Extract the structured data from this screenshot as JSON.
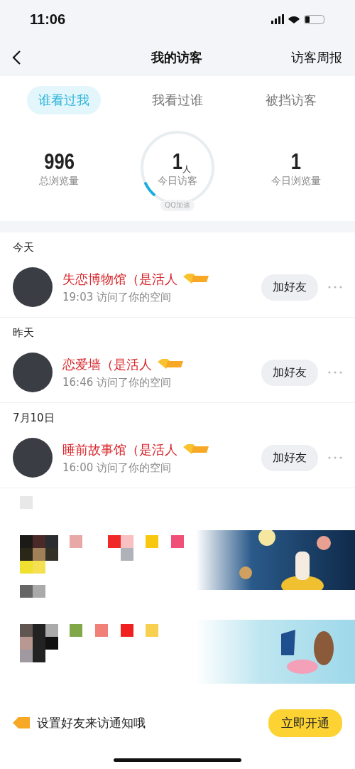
{
  "status_bar": {
    "time": "11:06"
  },
  "nav": {
    "title": "我的访客",
    "action": "访客周报"
  },
  "tabs": [
    {
      "label": "谁看过我",
      "selected": true
    },
    {
      "label": "我看过谁",
      "selected": false
    },
    {
      "label": "被挡访客",
      "selected": false
    }
  ],
  "stats": [
    {
      "kind": "plain",
      "value": "996",
      "label": "总浏览量"
    },
    {
      "kind": "gauge",
      "value": "1",
      "unit": "人",
      "label": "今日访客",
      "tag": "QQ加速"
    },
    {
      "kind": "plain",
      "value": "1",
      "label": "今日浏览量"
    }
  ],
  "groups": [
    {
      "date": "今天",
      "visitors": [
        {
          "name": "失恋博物馆（是活人",
          "time": "19:03 访问了你的空间",
          "button": "加好友"
        }
      ]
    },
    {
      "date": "昨天",
      "visitors": [
        {
          "name": "恋爱墙（是活人",
          "time": "16:46 访问了你的空间",
          "button": "加好友"
        }
      ]
    },
    {
      "date": "7月10日",
      "visitors": [
        {
          "name": "睡前故事馆（是活人",
          "time": "16:00 访问了你的空间",
          "button": "加好友"
        }
      ]
    }
  ],
  "notice": {
    "text": "设置好友来访通知哦",
    "button": "立即开通"
  }
}
